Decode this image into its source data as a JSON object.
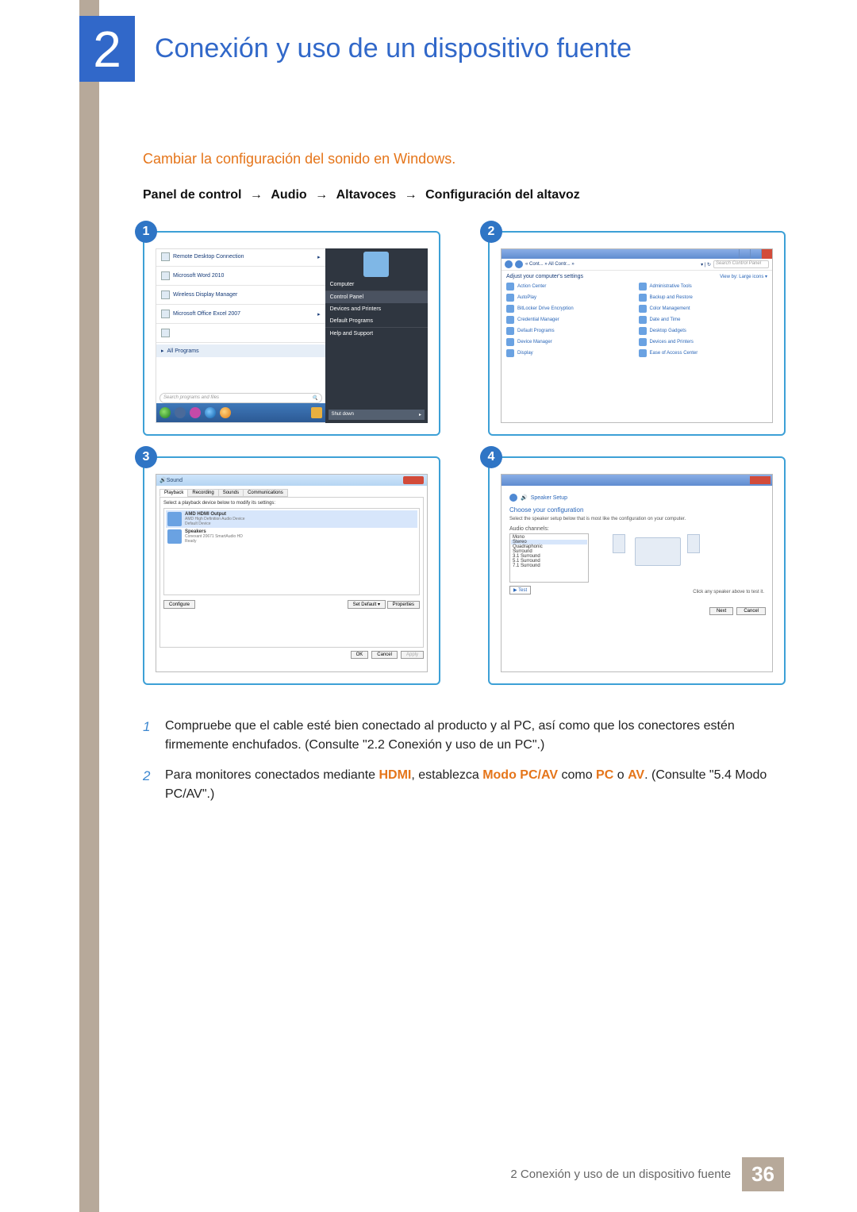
{
  "header": {
    "chapter_number": "2",
    "chapter_title": "Conexión y uso de un dispositivo fuente"
  },
  "subheading": "Cambiar la configuración del sonido en Windows.",
  "breadcrumb": {
    "p1": "Panel de control",
    "p2": "Audio",
    "p3": "Altavoces",
    "p4": "Configuración del altavoz",
    "arrow": "→"
  },
  "panels": {
    "badges": {
      "b1": "1",
      "b2": "2",
      "b3": "3",
      "b4": "4"
    },
    "p1": {
      "left_items": [
        "Remote Desktop Connection",
        "Microsoft Word 2010",
        "Wireless Display Manager",
        "Microsoft Office Excel 2007"
      ],
      "all_programs": "All Programs",
      "search_placeholder": "Search programs and files",
      "right_items": [
        "Computer",
        "Control Panel",
        "Devices and Printers",
        "Default Programs",
        "Help and Support"
      ],
      "shutdown": "Shut down"
    },
    "p2": {
      "crumb_mid": "« Cont... » All Contr... »",
      "search_placeholder": "Search Control Panel",
      "subtitle": "Adjust your computer's settings",
      "viewby": "View by:  Large icons ▾",
      "items_left": [
        "Action Center",
        "AutoPlay",
        "BitLocker Drive Encryption",
        "Credential Manager",
        "Default Programs",
        "Device Manager",
        "Display"
      ],
      "items_right": [
        "Administrative Tools",
        "Backup and Restore",
        "Color Management",
        "Date and Time",
        "Desktop Gadgets",
        "Devices and Printers",
        "Ease of Access Center"
      ]
    },
    "p3": {
      "title": "Sound",
      "tabs": [
        "Playback",
        "Recording",
        "Sounds",
        "Communications"
      ],
      "hint": "Select a playback device below to modify its settings:",
      "dev1": {
        "title": "AMD HDMI Output",
        "sub1": "AMD High Definition Audio Device",
        "sub2": "Default Device"
      },
      "dev2": {
        "title": "Speakers",
        "sub1": "Conexant 20671 SmartAudio HD",
        "sub2": "Ready"
      },
      "configure": "Configure",
      "set_default": "Set Default ▾",
      "properties": "Properties",
      "ok": "OK",
      "cancel": "Cancel",
      "apply": "Apply"
    },
    "p4": {
      "crumb": "Speaker Setup",
      "heading": "Choose your configuration",
      "hint": "Select the speaker setup below that is most like the configuration on your computer.",
      "channels_label": "Audio channels:",
      "options": [
        "Mono",
        "Stereo",
        "Quadraphonic",
        "Surround",
        "3.1 Surround",
        "5.1 Surround",
        "7.1 Surround"
      ],
      "test": "▶ Test",
      "note": "Click any speaker above to test it.",
      "next": "Next",
      "cancel": "Cancel"
    }
  },
  "steps": {
    "s1": {
      "num": "1",
      "text": "Compruebe que el cable esté bien conectado al producto y al PC, así como que los conectores estén firmemente enchufados. (Consulte \"2.2 Conexión y uso de un PC\".)"
    },
    "s2": {
      "num": "2",
      "pre": "Para monitores conectados mediante ",
      "hdmi": "HDMI",
      "mid1": ", establezca ",
      "modo": "Modo PC/AV",
      "mid2": " como ",
      "pc": "PC",
      "or": " o ",
      "av": "AV",
      "post": ". (Consulte \"5.4 Modo PC/AV\".)"
    }
  },
  "footer": {
    "text": "2 Conexión y uso de un dispositivo fuente",
    "page": "36"
  }
}
